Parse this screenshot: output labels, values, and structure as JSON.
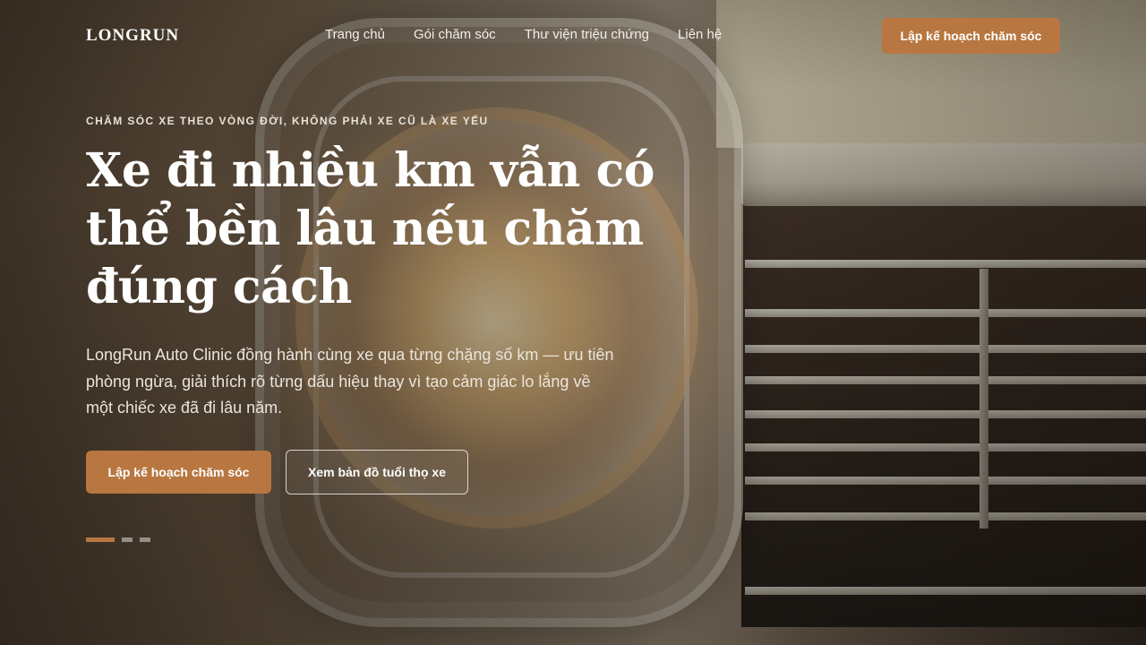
{
  "brand": {
    "logo": "LONGRUN",
    "accent_color": "#b87740"
  },
  "nav": {
    "items": [
      {
        "label": "Trang chủ"
      },
      {
        "label": "Gói chăm sóc"
      },
      {
        "label": "Thư viện triệu chứng"
      },
      {
        "label": "Liên hệ"
      }
    ],
    "cta_label": "Lập kế hoạch chăm sóc"
  },
  "hero": {
    "eyebrow": "CHĂM SÓC XE THEO VÒNG ĐỜI, KHÔNG PHẢI XE CŨ LÀ XE YẾU",
    "headline": "Xe đi nhiều km vẫn có thể bền lâu nếu chăm đúng cách",
    "lead": "LongRun Auto Clinic đồng hành cùng xe qua từng chặng số km — ưu tiên phòng ngừa, giải thích rõ từng dấu hiệu thay vì tạo cảm giác lo lắng về một chiếc xe đã đi lâu năm.",
    "primary_button": "Lập kế hoạch chăm sóc",
    "secondary_button": "Xem bản đồ tuổi thọ xe",
    "slides": {
      "count": 3,
      "active_index": 0
    }
  }
}
